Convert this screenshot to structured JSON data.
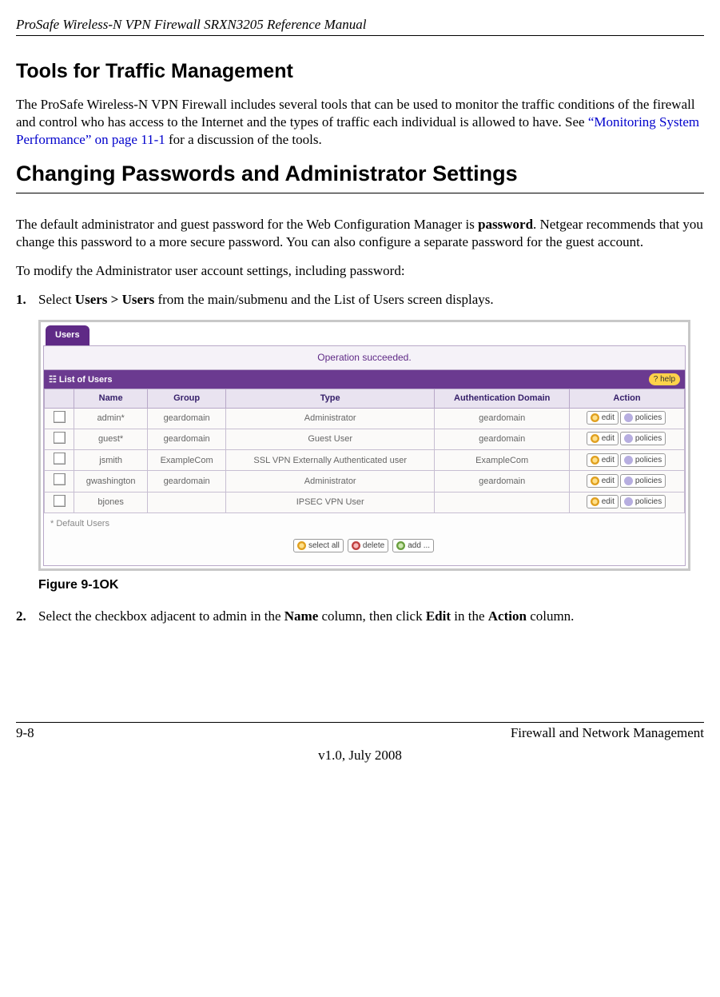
{
  "header": {
    "doc_title": "ProSafe Wireless-N VPN Firewall SRXN3205 Reference Manual"
  },
  "section1": {
    "title": "Tools for Traffic Management",
    "p_part1": "The ProSafe Wireless-N VPN Firewall includes several tools that can be used to monitor the traffic conditions of the firewall and control who has access to the Internet and the types of traffic each individual is allowed to have. See ",
    "link": "“Monitoring System Performance” on page 11-1",
    "p_part2": " for a discussion of the tools."
  },
  "section2": {
    "title": "Changing Passwords and Administrator Settings",
    "p_part1": "The default administrator and guest password for the Web Configuration Manager is ",
    "p_bold1": "password",
    "p_part2": ". Netgear recommends that you change this password to a more secure password. You can also configure a separate password for the guest account.",
    "p2": "To modify the Administrator user account settings, including password:"
  },
  "step1": {
    "num": "1.",
    "t1": "Select ",
    "b1": "Users > Users",
    "t2": " from the main/submenu and the List of Users screen displays."
  },
  "shot": {
    "tab": "Users",
    "opmsg": "Operation succeeded.",
    "subhead": "List of Users",
    "help": "help",
    "cols": {
      "name": "Name",
      "group": "Group",
      "type": "Type",
      "auth": "Authentication Domain",
      "action": "Action"
    },
    "rows": [
      {
        "name": "admin*",
        "group": "geardomain",
        "type": "Administrator",
        "auth": "geardomain"
      },
      {
        "name": "guest*",
        "group": "geardomain",
        "type": "Guest User",
        "auth": "geardomain"
      },
      {
        "name": "jsmith",
        "group": "ExampleCom",
        "type": "SSL VPN Externally Authenticated user",
        "auth": "ExampleCom"
      },
      {
        "name": "gwashington",
        "group": "geardomain",
        "type": "Administrator",
        "auth": "geardomain"
      },
      {
        "name": "bjones",
        "group": "",
        "type": "IPSEC VPN User",
        "auth": ""
      }
    ],
    "act_edit": "edit",
    "act_pol": "policies",
    "defnote": "* Default Users",
    "btn_selectall": "select all",
    "btn_delete": "delete",
    "btn_add": "add ..."
  },
  "fig_caption": "Figure 9-1OK",
  "step2": {
    "num": "2.",
    "t1": "Select the checkbox adjacent to admin in the ",
    "b1": "Name",
    "t2": " column, then click ",
    "b2": "Edit",
    "t3": " in the ",
    "b3": "Action",
    "t4": " column."
  },
  "footer": {
    "left": "9-8",
    "right": "Firewall and Network Management",
    "center": "v1.0, July 2008"
  }
}
